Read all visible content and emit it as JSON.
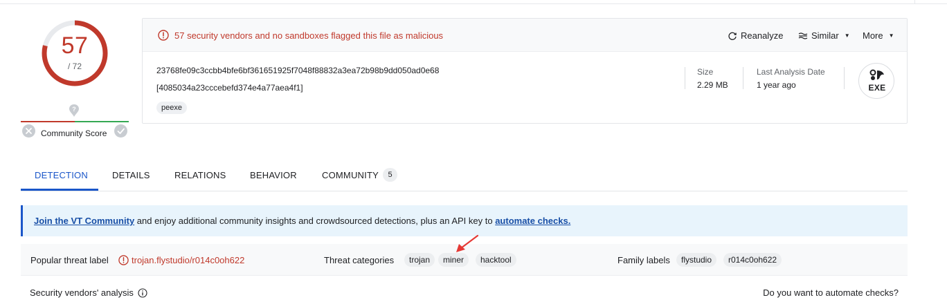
{
  "score": {
    "detections": "57",
    "total": "/ 72",
    "community_label": "Community Score"
  },
  "summary": {
    "alert": "57 security vendors and no sandboxes flagged this file as malicious",
    "actions": {
      "reanalyze": "Reanalyze",
      "similar": "Similar",
      "more": "More"
    },
    "sha256": "23768fe09c3ccbb4bfe6bf361651925f7048f88832a3ea72b98b9dd050ad0e68",
    "name": "[4085034a23cccebefd374e4a77aea4f1]",
    "tags": [
      "peexe"
    ],
    "size_label": "Size",
    "size_value": "2.29 MB",
    "last_analysis_label": "Last Analysis Date",
    "last_analysis_value": "1 year ago",
    "file_type": "EXE"
  },
  "tabs": [
    {
      "label": "DETECTION",
      "active": true
    },
    {
      "label": "DETAILS"
    },
    {
      "label": "RELATIONS"
    },
    {
      "label": "BEHAVIOR"
    },
    {
      "label": "COMMUNITY",
      "count": "5"
    }
  ],
  "banner": {
    "link1": "Join the VT Community",
    "middle": " and enjoy additional community insights and crowdsourced detections, plus an API key to ",
    "link2": "automate checks."
  },
  "threat": {
    "popular_label": "Popular threat label",
    "popular_value": "trojan.flystudio/r014c0oh622",
    "categories_label": "Threat categories",
    "categories": [
      "trojan",
      "miner",
      "hacktool"
    ],
    "family_label": "Family labels",
    "families": [
      "flystudio",
      "r014c0oh622"
    ]
  },
  "bottom": {
    "vendors_title": "Security vendors' analysis",
    "automate_question": "Do you want to automate checks?"
  },
  "colors": {
    "malicious": "#c0392b",
    "accent": "#1a56c9",
    "clean": "#34a853",
    "annotation_arrow": "#e53935"
  }
}
